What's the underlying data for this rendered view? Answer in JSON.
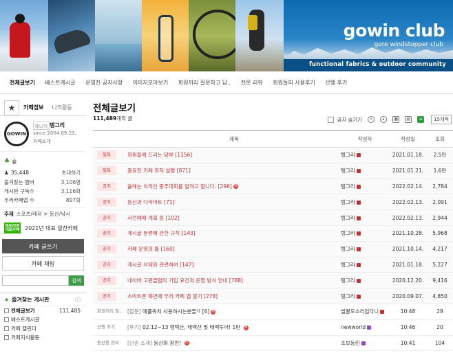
{
  "banner": {
    "logo_title": "gowin club",
    "logo_subtitle": "gore windstopper club",
    "tagline": "functional fabrics & outdoor community",
    "colors": {
      "brand_blue": "#0d6ab0",
      "band": "#0b4f87"
    }
  },
  "menu": [
    "전체글보기",
    "베스트게시글",
    "운영진 공지사항",
    "이미지모아보기",
    "회원끼리 질문하고 답..",
    "전문 리뷰",
    "회원들의 사용후기",
    "산행 후기"
  ],
  "sidebar": {
    "tab_info": "카페정보",
    "tab_activity": "나의활동",
    "manager_badge": "매니저",
    "manager_name": "텡그리",
    "since": "since 2004.09.23.",
    "intro": "카페소개",
    "logo_text": "GOWIN",
    "grade": "숲",
    "member_count": "35,448",
    "invite": "초대하기",
    "stats": [
      {
        "label": "즐겨찾는 멤버",
        "value": "3,106명"
      },
      {
        "label": "게시판 구독수",
        "value": "3,116회"
      },
      {
        "label": "우리카페앱 수",
        "value": "897회"
      }
    ],
    "topic_label": "주제",
    "topic_value": "스포츠/레저 > 등산/낚시",
    "naver_badge": "NAVER 대표카페",
    "naver_text": "2021년 대표 알찬카페",
    "write_button": "카페 글쓰기",
    "chat_button": "카페 채팅",
    "search_placeholder": "",
    "search_button": "검색",
    "fav_boards_title": "즐겨찾는 게시판",
    "fav_toggle": "ⓘ",
    "boards": [
      {
        "label": "전체글보기",
        "count": "111,485"
      },
      {
        "label": "베스트게시글",
        "count": ""
      },
      {
        "label": "카페 캘린더",
        "count": ""
      },
      {
        "label": "카페지식활동",
        "count": ""
      }
    ]
  },
  "main": {
    "title": "전체글보기",
    "post_count": "111,489",
    "post_count_suffix": "개의 글",
    "hide_notice": "공지 숨기기",
    "per_page": "15개씩",
    "headers": {
      "title": "제목",
      "writer": "작성자",
      "date": "작성일",
      "views": "조회"
    },
    "rows": [
      {
        "tag": "필독",
        "title": "회원들께 드리는 당부",
        "comments": "[1156]",
        "new": false,
        "writer": "텡그리",
        "date": "2021.01.18.",
        "views": "2.5만",
        "notice": true
      },
      {
        "tag": "필독",
        "title": "중요한 카페 회칙 설명",
        "comments": "[871]",
        "new": false,
        "writer": "텡그리",
        "date": "2021.01.21.",
        "views": "1.6만",
        "notice": true
      },
      {
        "tag": "공지",
        "title": "올해는 치리산 종주대회를 열려고 합니다.",
        "comments": "[296]",
        "new": true,
        "writer": "텡그리",
        "date": "2022.02.14.",
        "views": "2,784",
        "notice": true
      },
      {
        "tag": "공지",
        "title": "등산과 다이어트",
        "comments": "[71]",
        "new": false,
        "writer": "텡그리",
        "date": "2022.02.13.",
        "views": "2,091",
        "notice": true
      },
      {
        "tag": "공지",
        "title": "사전예매 계획 중",
        "comments": "[102]",
        "new": false,
        "writer": "텡그리",
        "date": "2022.02.13.",
        "views": "2,944",
        "notice": true
      },
      {
        "tag": "공지",
        "title": "게시글 분류에 관한 규칙",
        "comments": "[143]",
        "new": false,
        "writer": "텡그리",
        "date": "2021.10.28.",
        "views": "5,968",
        "notice": true
      },
      {
        "tag": "공지",
        "title": "카페 운영의 틀",
        "comments": "[160]",
        "new": false,
        "writer": "텡그리",
        "date": "2021.10.14.",
        "views": "4,217",
        "notice": true
      },
      {
        "tag": "공지",
        "title": "게시글 삭제와 관련하여",
        "comments": "[147]",
        "new": false,
        "writer": "텡그리",
        "date": "2021.01.18.",
        "views": "5,227",
        "notice": true
      },
      {
        "tag": "공지",
        "title": "네이버 고윈클럽의 가입 요건과 운영 방식 안내",
        "comments": "[788]",
        "new": false,
        "writer": "텡그리",
        "date": "2020.12.20.",
        "views": "9,416",
        "notice": true
      },
      {
        "tag": "공지",
        "title": "스마트폰 화면에 우리 카페 앱 깔기",
        "comments": "[278]",
        "new": false,
        "writer": "텡그리",
        "date": "2020.09.07.",
        "views": "4,850",
        "notice": true
      },
      {
        "tag": "회원끼리 질...",
        "prefix": "[잡문]",
        "title": "애플워치 사용하시는분들!!",
        "comments": "[6]",
        "new": true,
        "writer": "벌꿀오소리입다니",
        "date": "10:48",
        "views": "28",
        "notice": false
      },
      {
        "tag": "산행 후기",
        "prefix": "[후기]",
        "title": "02.12~13 행택산, 태백산 및 태백투어! 1탄",
        "comments": "",
        "new": true,
        "writer": "newworld",
        "date": "10:46",
        "views": "20",
        "notice": false
      },
      {
        "tag": "등산용 장비",
        "prefix": "[단순 소개]",
        "title": "등산화 장만!",
        "comments": "",
        "new": true,
        "writer": "조보등린",
        "date": "10:41",
        "views": "104",
        "notice": false
      }
    ]
  }
}
